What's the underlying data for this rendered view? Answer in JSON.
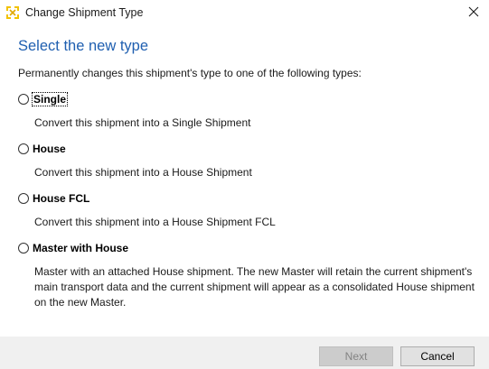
{
  "window": {
    "title": "Change Shipment Type",
    "app_icon": "shipment-type-icon",
    "close_icon": "close-icon"
  },
  "main": {
    "heading": "Select the new type",
    "description": "Permanently changes this shipment's type to one of the following types:",
    "options": [
      {
        "label": "Single",
        "description": "Convert this shipment into a Single Shipment",
        "selected": false,
        "focused": true
      },
      {
        "label": "House",
        "description": "Convert this shipment into a House Shipment",
        "selected": false
      },
      {
        "label": "House FCL",
        "description": "Convert this shipment into a House Shipment FCL",
        "selected": false
      },
      {
        "label": "Master with House",
        "description": "Master with an attached House shipment. The new Master will retain the current shipment's main transport data and the current shipment will appear as a consolidated House shipment on the new Master.",
        "selected": false
      }
    ]
  },
  "footer": {
    "next_label": "Next",
    "next_enabled": false,
    "cancel_label": "Cancel"
  },
  "colors": {
    "heading": "#1f5fb0",
    "app_icon": "#f2c200",
    "footer_bg": "#f0f0f0"
  }
}
